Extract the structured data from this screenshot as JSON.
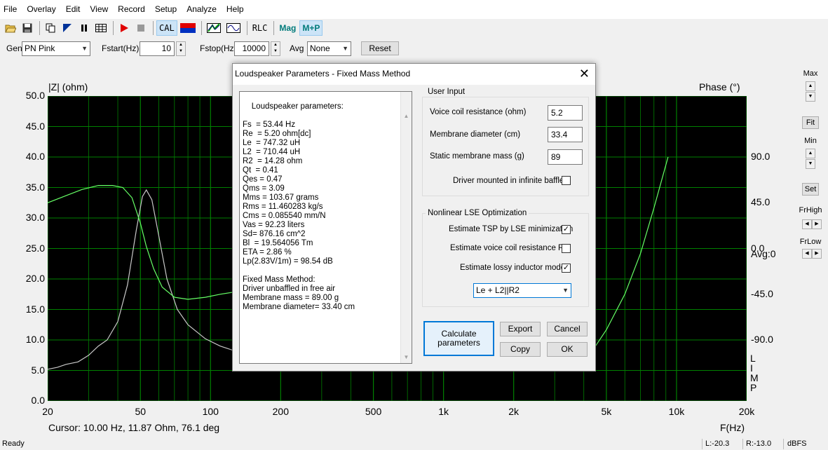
{
  "menu": [
    "File",
    "Overlay",
    "Edit",
    "View",
    "Record",
    "Setup",
    "Analyze",
    "Help"
  ],
  "toolbar": {
    "cal": "CAL",
    "rlc": "RLC",
    "mag": "Mag",
    "mp": "M+P"
  },
  "genrow": {
    "gen_label": "Gen",
    "gen_value": "PN Pink",
    "fstart_label": "Fstart(Hz)",
    "fstart_value": "10",
    "fstop_label": "Fstop(Hz)",
    "fstop_value": "10000",
    "avg_label": "Avg",
    "avg_value": "None",
    "reset_label": "Reset"
  },
  "graph": {
    "y_left_label": "|Z| (ohm)",
    "y_right_label": "Phase (°)",
    "x_label": "F(Hz)",
    "cursor_text": "Cursor: 10.00 Hz, 11.87 Ohm, 76.1 deg",
    "avg_text": "Avg:0",
    "limp_letters": [
      "L",
      "I",
      "M",
      "P"
    ],
    "y_left_ticks": [
      "50.0",
      "45.0",
      "40.0",
      "35.0",
      "30.0",
      "25.0",
      "20.0",
      "15.0",
      "10.0",
      "5.0",
      "0.0"
    ],
    "y_right_ticks": [
      "90.0",
      "45.0",
      "0.0",
      "-45.0",
      "-90.0"
    ],
    "x_ticks": [
      "20",
      "50",
      "100",
      "200",
      "500",
      "1k",
      "2k",
      "5k",
      "10k",
      "20k"
    ]
  },
  "right_panel": {
    "max": "Max",
    "fit": "Fit",
    "min": "Min",
    "set": "Set",
    "frhigh": "FrHigh",
    "frlow": "FrLow"
  },
  "status": {
    "ready": "Ready",
    "left": "L:-20.3",
    "right": "R:-13.0",
    "unit": "dBFS"
  },
  "dialog": {
    "title": "Loudspeaker Parameters - Fixed Mass Method",
    "results": "Loudspeaker parameters:\n\nFs  = 53.44 Hz\nRe  = 5.20 ohm[dc]\nLe  = 747.32 uH\nL2  = 710.44 uH\nR2  = 14.28 ohm\nQt  = 0.41\nQes = 0.47\nQms = 3.09\nMms = 103.67 grams\nRms = 11.460283 kg/s\nCms = 0.085540 mm/N\nVas = 92.23 liters\nSd= 876.16 cm^2\nBl  = 19.564056 Tm\nETA = 2.86 %\nLp(2.83V/1m) = 98.54 dB\n\nFixed Mass Method:\nDriver unbaffled in free air\nMembrane mass = 89.00 g\nMembrane diameter= 33.40 cm",
    "user_input_title": "User Input",
    "vc_label": "Voice coil resistance (ohm)",
    "vc_value": "5.2",
    "md_label": "Membrane diameter (cm)",
    "md_value": "33.4",
    "mass_label": "Static membrane mass (g)",
    "mass_value": "89",
    "baffle_label": "Driver mounted in infinite baffle",
    "lse_title": "Nonlinear LSE Optimization",
    "tsp_label": "Estimate TSP by LSE minimization",
    "re_label": "Estimate voice coil resistance Re",
    "lossy_label": "Estimate lossy inductor model",
    "model_value": "Le + L2||R2",
    "calc_label_1": "Calculate",
    "calc_label_2": "parameters",
    "export_label": "Export",
    "cancel_label": "Cancel",
    "copy_label": "Copy",
    "ok_label": "OK",
    "checks": {
      "baffle": false,
      "tsp": true,
      "re": false,
      "lossy": true
    }
  },
  "colors": {
    "plot_bg": "#000000",
    "grid": "#008000",
    "impedance": "#c8c8c8",
    "phase": "#66ff66"
  }
}
